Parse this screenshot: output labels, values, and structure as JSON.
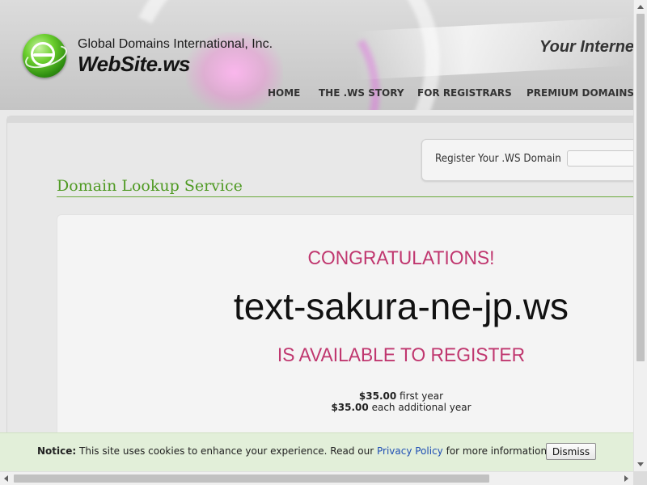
{
  "header": {
    "company_name": "Global Domains International, Inc.",
    "brand_name": "WebSite.ws",
    "tagline": "Your Interne",
    "logo_icon": "globe-e-logo-icon"
  },
  "nav": {
    "items": [
      {
        "label": "HOME"
      },
      {
        "label": "THE .WS STORY"
      },
      {
        "label": "FOR REGISTRARS"
      },
      {
        "label": "PREMIUM DOMAINS"
      }
    ]
  },
  "register": {
    "label": "Register Your .WS Domain",
    "input_value": ""
  },
  "main": {
    "section_title": "Domain Lookup Service",
    "result": {
      "heading": "CONGRATULATIONS!",
      "domain": "text-sakura-ne-jp.ws",
      "status": "IS AVAILABLE TO REGISTER",
      "price_first": "$35.00",
      "price_first_suffix": "first year",
      "price_additional": "$35.00",
      "price_additional_suffix": "each additional year"
    }
  },
  "cookie_notice": {
    "label": "Notice:",
    "text_before": "This site uses cookies to enhance your experience. Read our",
    "link_text": "Privacy Policy",
    "text_after": "for more information.",
    "dismiss_label": "Dismiss"
  },
  "colors": {
    "accent_green": "#4f9a23",
    "accent_magenta": "#c0376f",
    "cookie_bg": "#e2efd9",
    "link_blue": "#1f4fb4"
  }
}
